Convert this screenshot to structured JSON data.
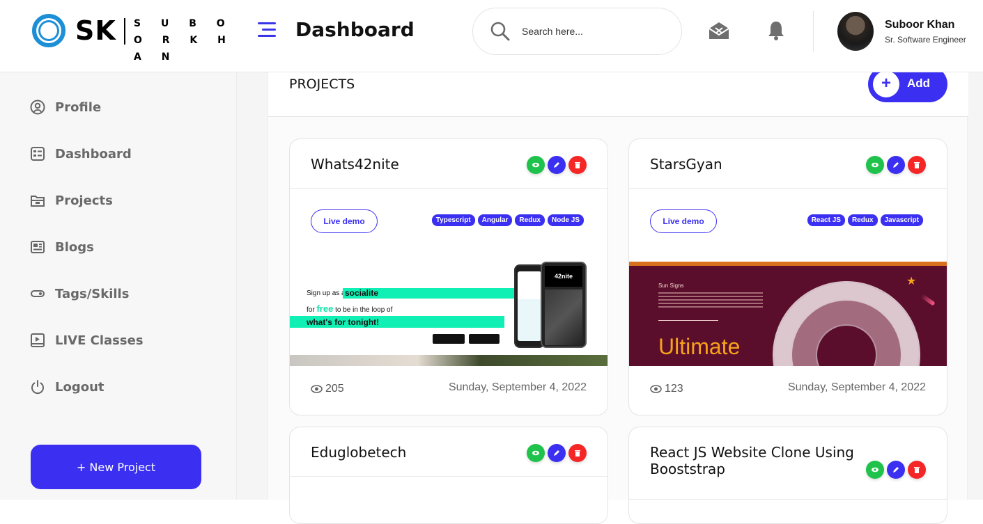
{
  "brand": {
    "initials": "SK",
    "name": "S U B O O R K H A N"
  },
  "header": {
    "title": "Dashboard",
    "search_placeholder": "Search here...",
    "user_name": "Suboor Khan",
    "user_role": "Sr. Software Engineer"
  },
  "sidebar": {
    "items": [
      {
        "label": "Profile",
        "icon": "user-circle-icon"
      },
      {
        "label": "Dashboard",
        "icon": "dashboard-icon"
      },
      {
        "label": "Projects",
        "icon": "folder-icon"
      },
      {
        "label": "Blogs",
        "icon": "newspaper-icon"
      },
      {
        "label": "Tags/Skills",
        "icon": "tag-icon"
      },
      {
        "label": "LIVE Classes",
        "icon": "video-icon"
      },
      {
        "label": "Logout",
        "icon": "power-icon"
      }
    ],
    "new_project_label": "+ New Project"
  },
  "projects": {
    "title": "PROJECTS",
    "add_label": "Add",
    "plus": "+",
    "cards": [
      {
        "title": "Whats42nite",
        "live_label": "Live demo",
        "tags": [
          "Typescript",
          "Angular",
          "Redux",
          "Node JS"
        ],
        "views": "205",
        "date": "Sunday, September 4, 2022"
      },
      {
        "title": "StarsGyan",
        "live_label": "Live demo",
        "tags": [
          "React JS",
          "Redux",
          "Javascript"
        ],
        "views": "123",
        "date": "Sunday, September 4, 2022"
      },
      {
        "title": "Eduglobetech"
      },
      {
        "title": "React JS Website Clone Using Booststrap"
      }
    ]
  },
  "thumb1": {
    "line1a": "Sign up as a",
    "line1b": "socialite",
    "line2a": "for",
    "line2b": "free",
    "line2c": "to be in the loop of",
    "line3": "what's for tonight!",
    "brand": "42nite"
  },
  "thumb2": {
    "heading": "Sun Signs",
    "big": "Ultimate"
  },
  "colors": {
    "accent": "#3b30f1",
    "view": "#1fc24a",
    "edit": "#3b30f1",
    "delete": "#f52626"
  }
}
